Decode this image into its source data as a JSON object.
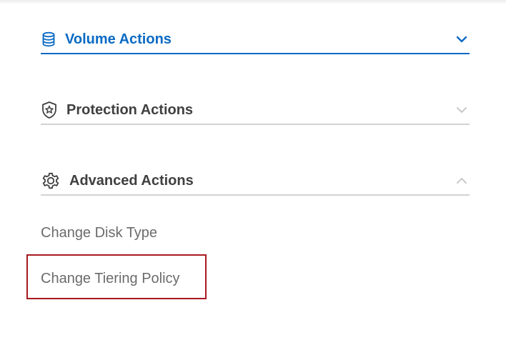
{
  "sections": {
    "volume": {
      "title": "Volume Actions",
      "icon": "database-icon",
      "state": "expanded",
      "accent": "#0a6ac4"
    },
    "protection": {
      "title": "Protection Actions",
      "icon": "shield-star-icon",
      "state": "collapsed"
    },
    "advanced": {
      "title": "Advanced Actions",
      "icon": "gear-icon",
      "state": "expanded",
      "items": [
        {
          "label": "Change Disk Type"
        },
        {
          "label": "Change Tiering Policy",
          "highlighted": true
        }
      ]
    }
  },
  "colors": {
    "accent": "#0a6ac4",
    "text": "#404040",
    "muted_text": "#6b6b6b",
    "divider": "#d2d2d2",
    "highlight": "#a8191f"
  }
}
